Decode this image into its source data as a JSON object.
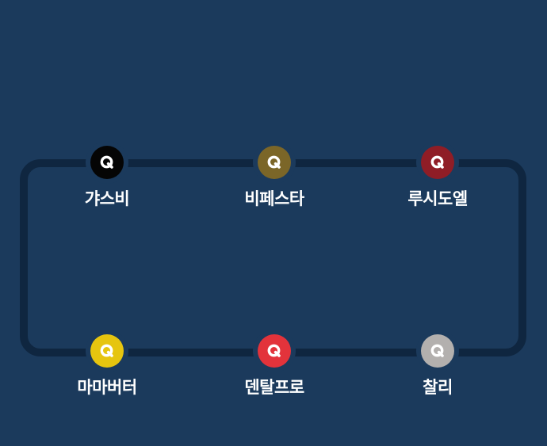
{
  "stations": [
    {
      "name": "갸스비",
      "color": "#050505",
      "icon": "q-brand-icon"
    },
    {
      "name": "비페스타",
      "color": "#7b6628",
      "icon": "q-brand-icon"
    },
    {
      "name": "루시도엘",
      "color": "#8f1d26",
      "icon": "q-brand-icon"
    },
    {
      "name": "마마버터",
      "color": "#e6c50f",
      "icon": "q-brand-icon"
    },
    {
      "name": "덴탈프로",
      "color": "#e3333b",
      "icon": "q-brand-icon"
    },
    {
      "name": "찰리",
      "color": "#b3b0ae",
      "icon": "q-brand-icon"
    }
  ]
}
